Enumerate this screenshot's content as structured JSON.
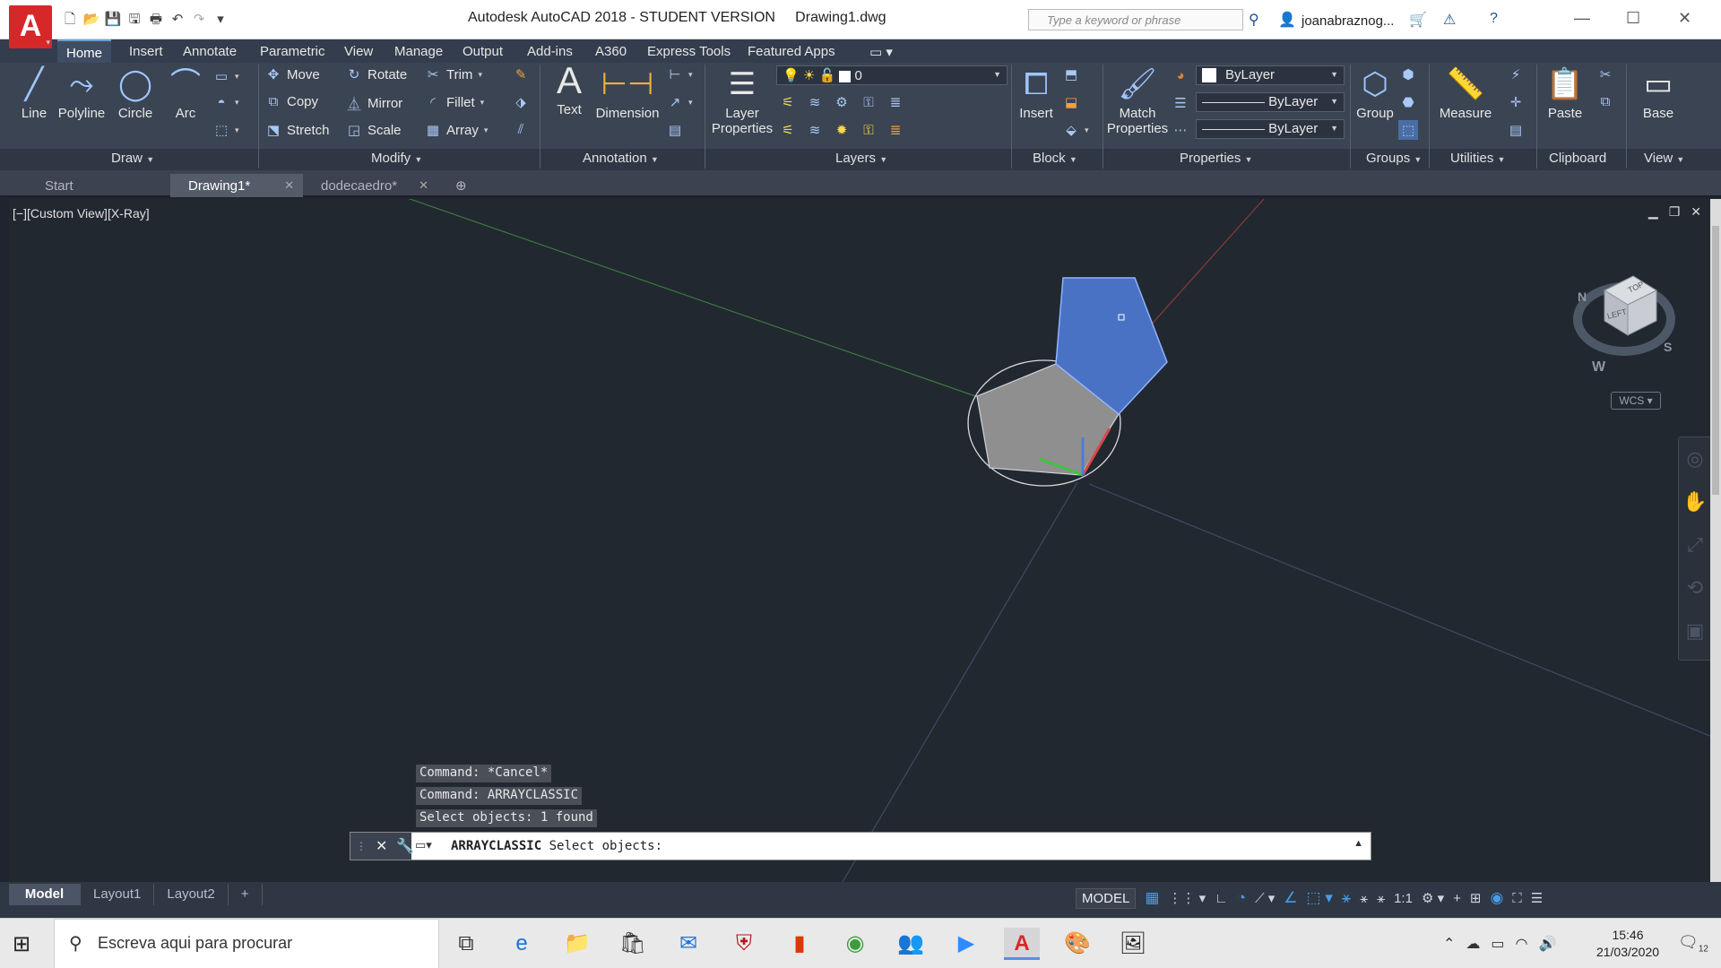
{
  "window": {
    "title": "Autodesk AutoCAD 2018 - STUDENT VERSION     Drawing1.dwg",
    "search_placeholder": "Type a keyword or phrase",
    "user": "joanabraznog...",
    "controls": [
      "—",
      "☐",
      "✕"
    ]
  },
  "quick_access": [
    "new-icon",
    "open-icon",
    "save-icon",
    "saveas-icon",
    "plot-icon",
    "undo-icon",
    "redo-icon",
    "customize-icon"
  ],
  "ribbon_tabs": [
    "Home",
    "Insert",
    "Annotate",
    "Parametric",
    "View",
    "Manage",
    "Output",
    "Add-ins",
    "A360",
    "Express Tools",
    "Featured Apps"
  ],
  "draw": {
    "panel": "Draw",
    "line": "Line",
    "polyline": "Polyline",
    "circle": "Circle",
    "arc": "Arc"
  },
  "modify": {
    "panel": "Modify",
    "move": "Move",
    "rotate": "Rotate",
    "trim": "Trim",
    "copy": "Copy",
    "mirror": "Mirror",
    "fillet": "Fillet",
    "stretch": "Stretch",
    "scale": "Scale",
    "array": "Array"
  },
  "annotation": {
    "panel": "Annotation",
    "text": "Text",
    "dimension": "Dimension"
  },
  "layers": {
    "panel": "Layers",
    "layer_properties_line1": "Layer",
    "layer_properties_line2": "Properties",
    "current_layer": "0"
  },
  "block": {
    "panel": "Block",
    "insert": "Insert"
  },
  "properties": {
    "panel": "Properties",
    "match_line1": "Match",
    "match_line2": "Properties",
    "color": "ByLayer",
    "linetype": "ByLayer",
    "lineweight": "ByLayer"
  },
  "groups": {
    "panel": "Groups",
    "group": "Group"
  },
  "utilities": {
    "panel": "Utilities",
    "measure": "Measure"
  },
  "clipboard": {
    "panel": "Clipboard",
    "paste": "Paste"
  },
  "view_panel": {
    "panel": "View",
    "base": "Base"
  },
  "doc_tabs": [
    "Start",
    "Drawing1*",
    "dodecaedro*"
  ],
  "viewport": {
    "label": "[−][Custom View][X-Ray]",
    "viewcube_top": "TOP",
    "viewcube_left": "LEFT",
    "compass": [
      "N",
      "S",
      "W"
    ],
    "wcs": "WCS"
  },
  "command_history": [
    "Command: *Cancel*",
    "Command: ARRAYCLASSIC",
    "Select objects: 1 found"
  ],
  "command_line": {
    "command": "ARRAYCLASSIC",
    "prompt": " Select objects:"
  },
  "layout_tabs": [
    "Model",
    "Layout1",
    "Layout2"
  ],
  "status": {
    "model": "MODEL",
    "scale": "1:1"
  },
  "taskbar": {
    "search": "Escreva aqui para procurar",
    "time": "15:46",
    "date": "21/03/2020",
    "notifications": "12"
  },
  "colors": {
    "ribbon": "#3b4452",
    "viewport": "#212830",
    "selection": "#4a72c4",
    "autocad_red": "#d62828"
  }
}
